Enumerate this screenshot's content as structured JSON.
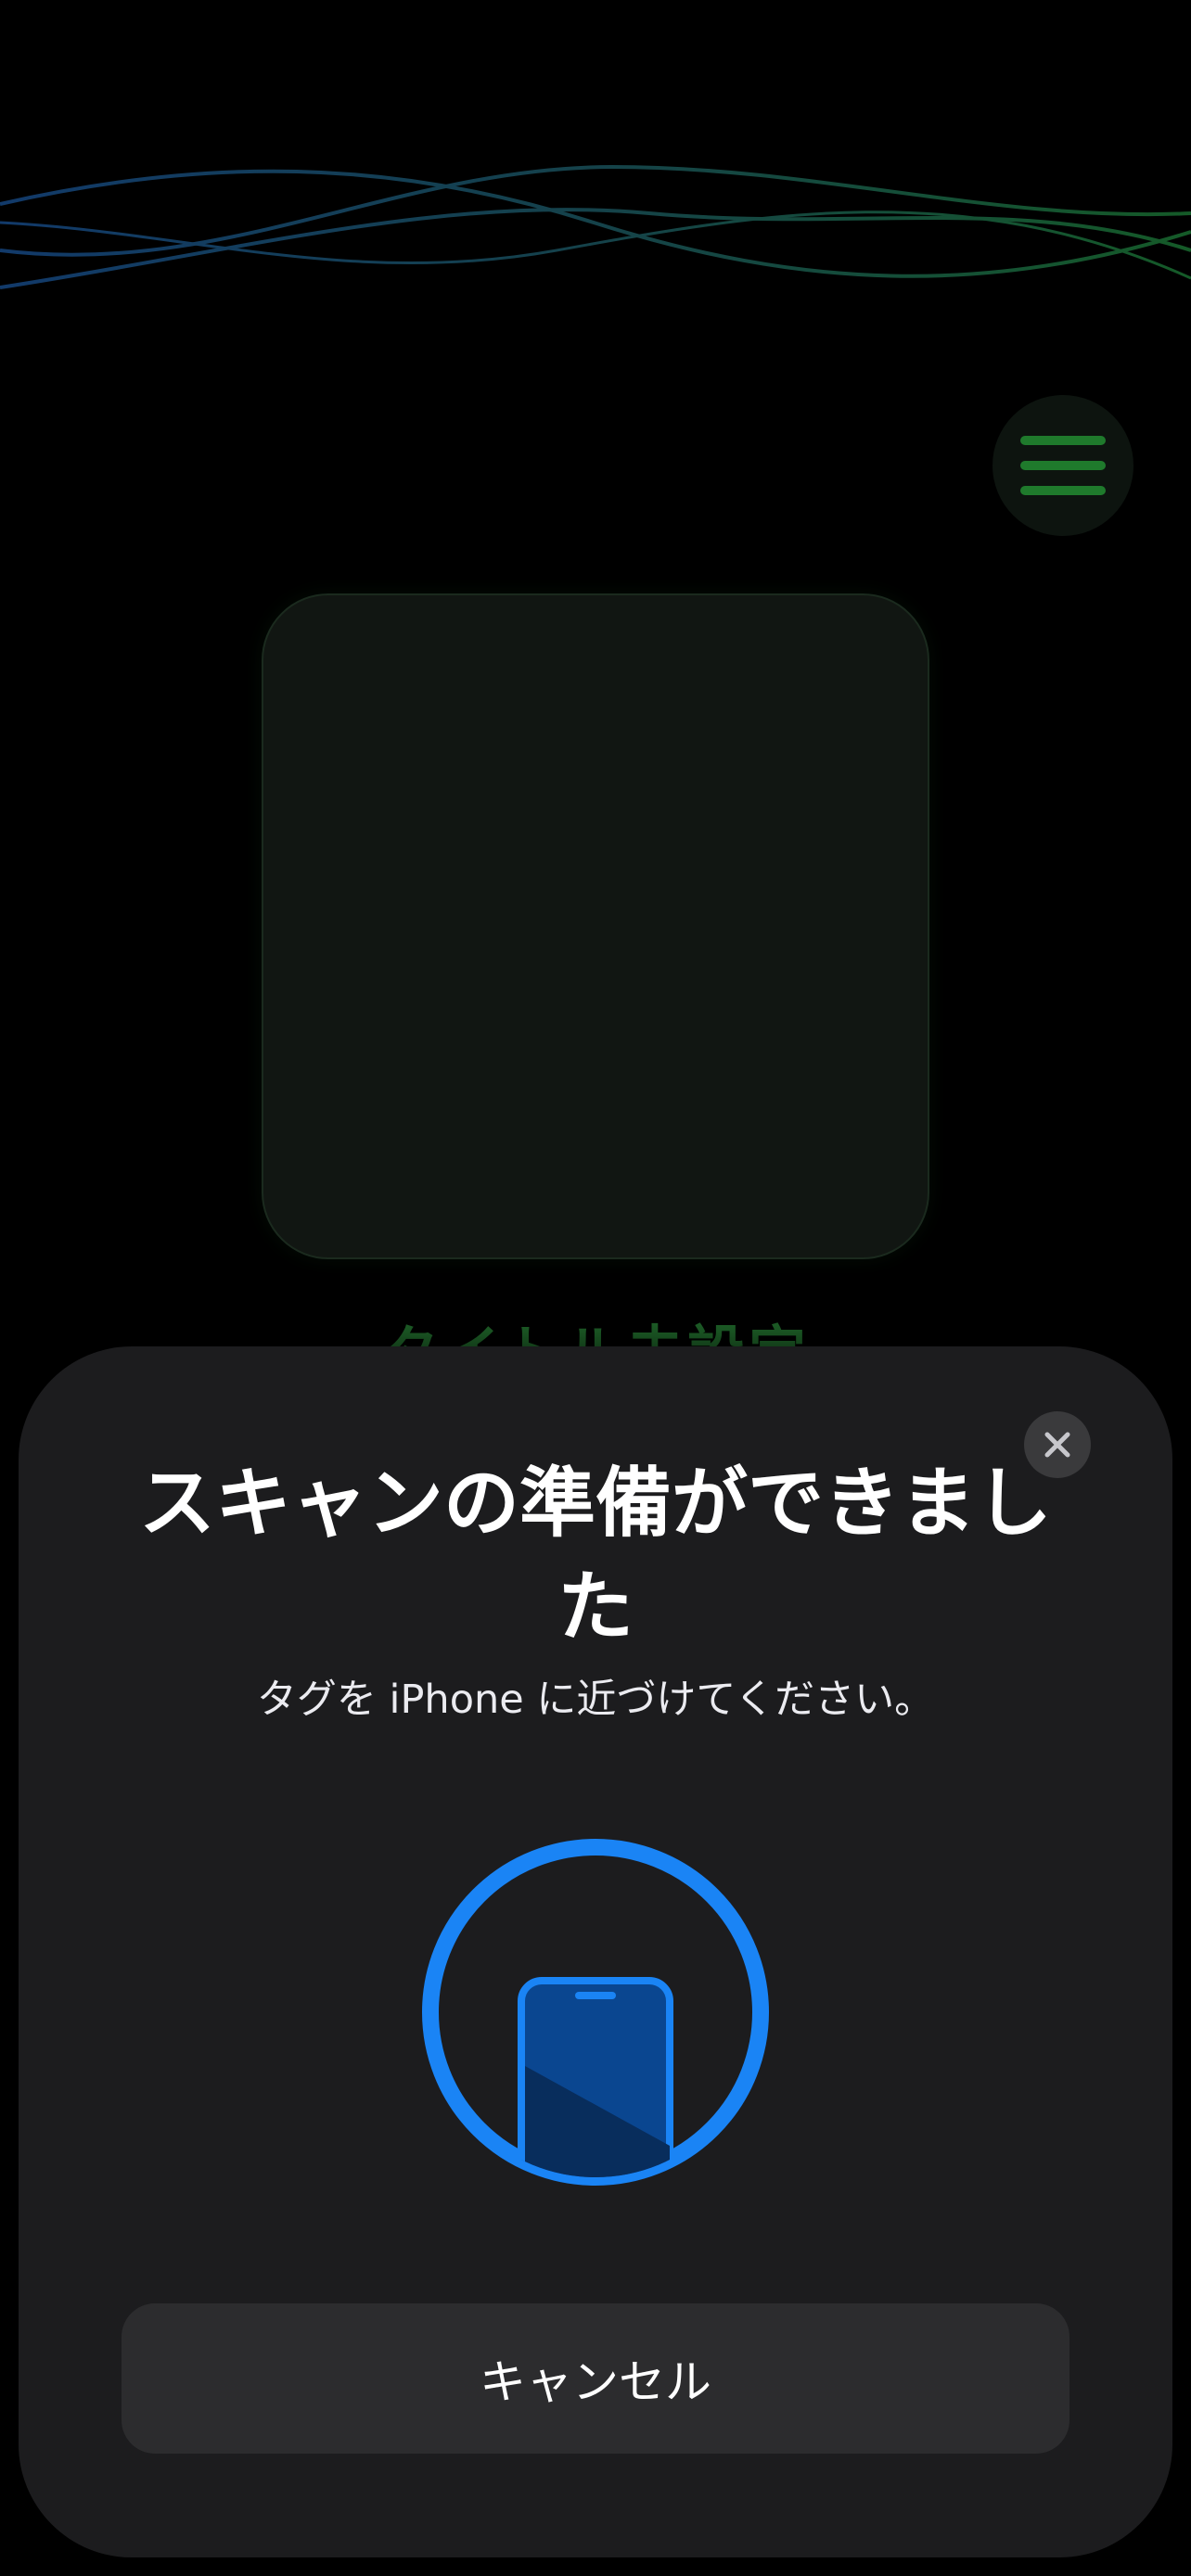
{
  "background": {
    "title": "タイトル未設定",
    "menu_icon": "hamburger-menu-icon",
    "accent_color": "#1f7a2c"
  },
  "nfc_sheet": {
    "title": "スキャンの準備ができました",
    "subtitle": "タグを iPhone に近づけてください。",
    "cancel_label": "キャンセル",
    "close_icon": "close-icon",
    "illustration_icon": "iphone-scan-icon",
    "accent_color": "#1a84f5"
  }
}
